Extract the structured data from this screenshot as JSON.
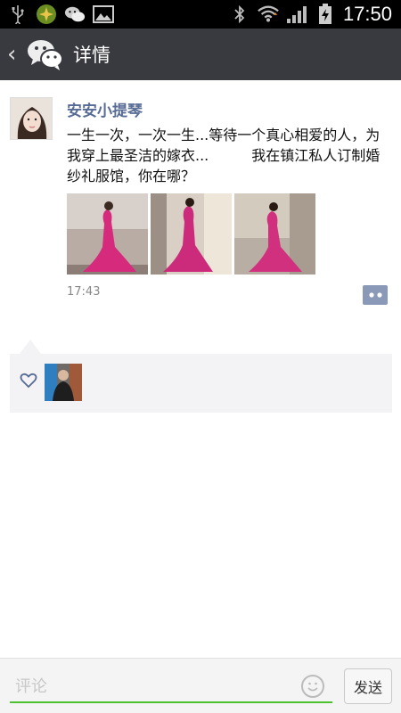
{
  "status_bar": {
    "time": "17:50",
    "icons": [
      "usb-icon",
      "app-icon",
      "wechat-icon",
      "image-icon",
      "bluetooth-icon",
      "wifi-icon",
      "signal-icon",
      "battery-charging-icon"
    ]
  },
  "header": {
    "back_icon": "chevron-left-icon",
    "logo_icon": "wechat-logo-icon",
    "title": "详情"
  },
  "post": {
    "nickname": "安安小提琴",
    "text": "一生一次，一次一生...等待一个真心相爱的人，为我穿上最圣洁的嫁衣...　　　我在镇江私人订制婚纱礼服馆，你在哪？",
    "photo_count": 3,
    "time": "17:43",
    "more_icon": "more-dots-icon"
  },
  "likes": {
    "heart_icon": "heart-outline-icon"
  },
  "comment_bar": {
    "placeholder": "评论",
    "emoji_icon": "smiley-icon",
    "send_label": "发送"
  },
  "colors": {
    "titlebar": "#393a3f",
    "nickname": "#576b95",
    "input_underline": "#4cc22e",
    "likes_bg": "#f3f3f5"
  }
}
